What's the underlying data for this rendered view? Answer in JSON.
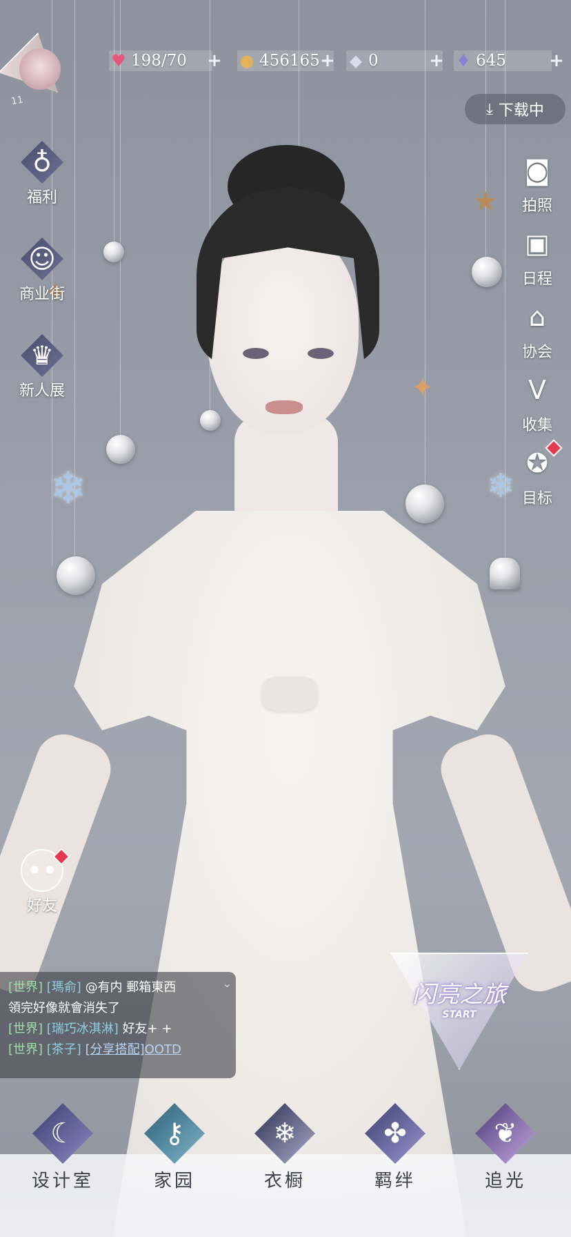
{
  "player": {
    "level": "11",
    "avatar_icon": "character-portrait"
  },
  "resources": {
    "stamina": {
      "icon": "heart-gem-icon",
      "value": "198/70",
      "color": "#e8557a"
    },
    "gold": {
      "icon": "gold-coin-icon",
      "value": "456165",
      "color": "#e3b25a"
    },
    "crystal": {
      "icon": "crystal-icon",
      "value": "0",
      "color": "#d8dbe8"
    },
    "diamond": {
      "icon": "diamond-icon",
      "value": "645",
      "color": "#8a7fd6"
    }
  },
  "download": {
    "label": "下载中",
    "icon": "download-icon"
  },
  "left_menu": [
    {
      "label": "福利",
      "icon": "hot-air-balloon-icon"
    },
    {
      "label": "商业街",
      "icon": "shopping-bag-icon"
    },
    {
      "label": "新人展",
      "icon": "trophy-icon"
    }
  ],
  "right_menu": [
    {
      "label": "拍照",
      "icon": "camera-icon"
    },
    {
      "label": "日程",
      "icon": "calendar-icon"
    },
    {
      "label": "协会",
      "icon": "guild-hall-icon"
    },
    {
      "label": "收集",
      "icon": "collection-v-icon"
    },
    {
      "label": "目标",
      "icon": "medal-icon"
    }
  ],
  "friends": {
    "label": "好友",
    "icon": "chat-bubble-icon"
  },
  "chat": [
    {
      "channel": "[世界]",
      "user": "[瑪俞]",
      "text": "@有内 郵箱東西"
    },
    {
      "channel": "",
      "user": "",
      "text": "領完好像就會消失了"
    },
    {
      "channel": "[世界]",
      "user": "[瑞巧冰淇淋]",
      "text": "好友+ +"
    },
    {
      "channel": "[世界]",
      "user": "[茶子]",
      "text": "[分享搭配]OOTD"
    }
  ],
  "event": {
    "title": "闪亮之旅",
    "subtitle": "START"
  },
  "bottom_nav": [
    {
      "label": "设计室",
      "icon": "moon-pendant-icon"
    },
    {
      "label": "家园",
      "icon": "key-icon"
    },
    {
      "label": "衣橱",
      "icon": "snowflake-icon"
    },
    {
      "label": "羁绊",
      "icon": "clover-icon"
    },
    {
      "label": "追光",
      "icon": "butterfly-icon"
    }
  ]
}
